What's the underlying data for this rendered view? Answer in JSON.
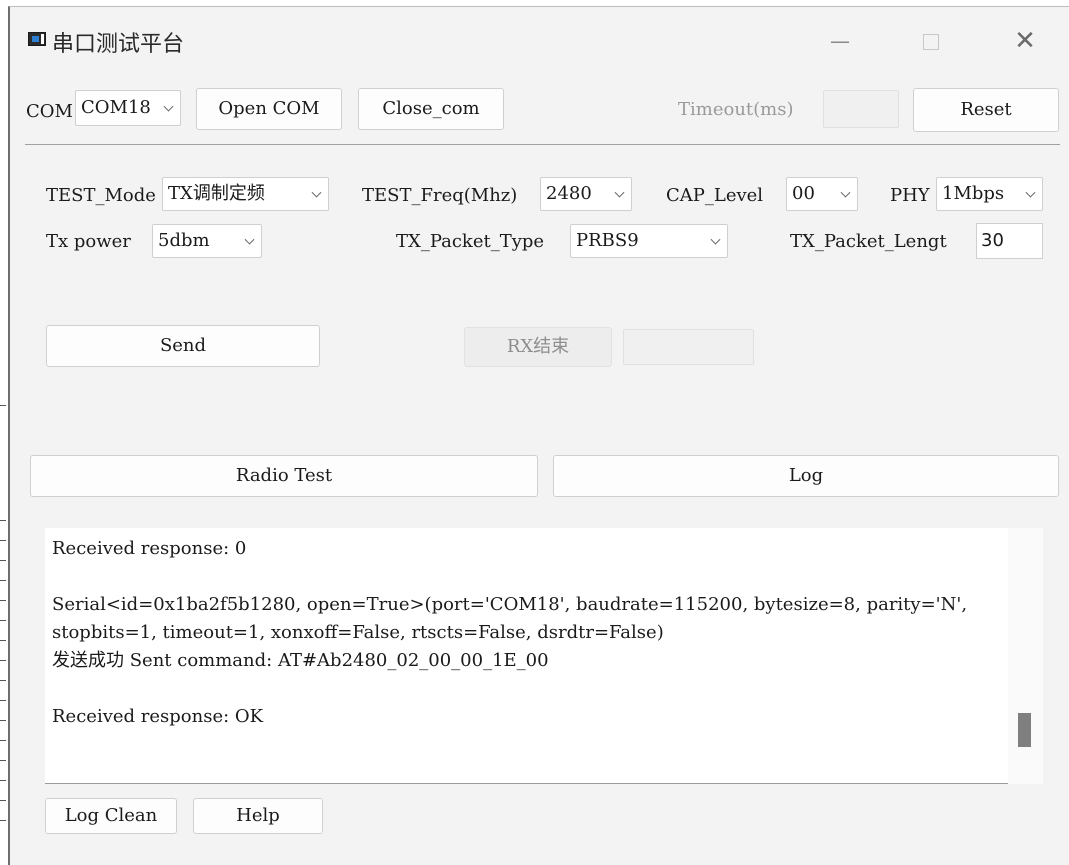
{
  "window": {
    "title": "串口测试平台",
    "min_glyph": "—",
    "close_glyph": "✕"
  },
  "toolbar": {
    "com_label": "COM",
    "com_value": "COM18",
    "open_com": "Open COM",
    "close_com": "Close_com",
    "timeout_label": "Timeout(ms)",
    "timeout_value": "",
    "reset": "Reset"
  },
  "settings": {
    "test_mode_label": "TEST_Mode",
    "test_mode_value": "TX调制定频",
    "test_freq_label": "TEST_Freq(Mhz)",
    "test_freq_value": "2480",
    "cap_level_label": "CAP_Level",
    "cap_level_value": "00",
    "phy_label": "PHY",
    "phy_value": "1Mbps",
    "tx_power_label": "Tx power",
    "tx_power_value": "5dbm",
    "packet_type_label": "TX_Packet_Type",
    "packet_type_value": "PRBS9",
    "packet_length_label": "TX_Packet_Lengt",
    "packet_length_value": "30"
  },
  "actions": {
    "send": "Send",
    "rx_end": "RX结束",
    "rx_value": ""
  },
  "tabs": {
    "radio_test": "Radio Test",
    "log": "Log"
  },
  "log": {
    "text": "Received response: 0\n\nSerial<id=0x1ba2f5b1280, open=True>(port='COM18', baudrate=115200, bytesize=8, parity='N', stopbits=1, timeout=1, xonxoff=False, rtscts=False, dsrdtr=False)\n发送成功 Sent command: AT#Ab2480_02_00_00_1E_00\n\nReceived response: OK"
  },
  "footer": {
    "log_clean": "Log Clean",
    "help": "Help"
  }
}
